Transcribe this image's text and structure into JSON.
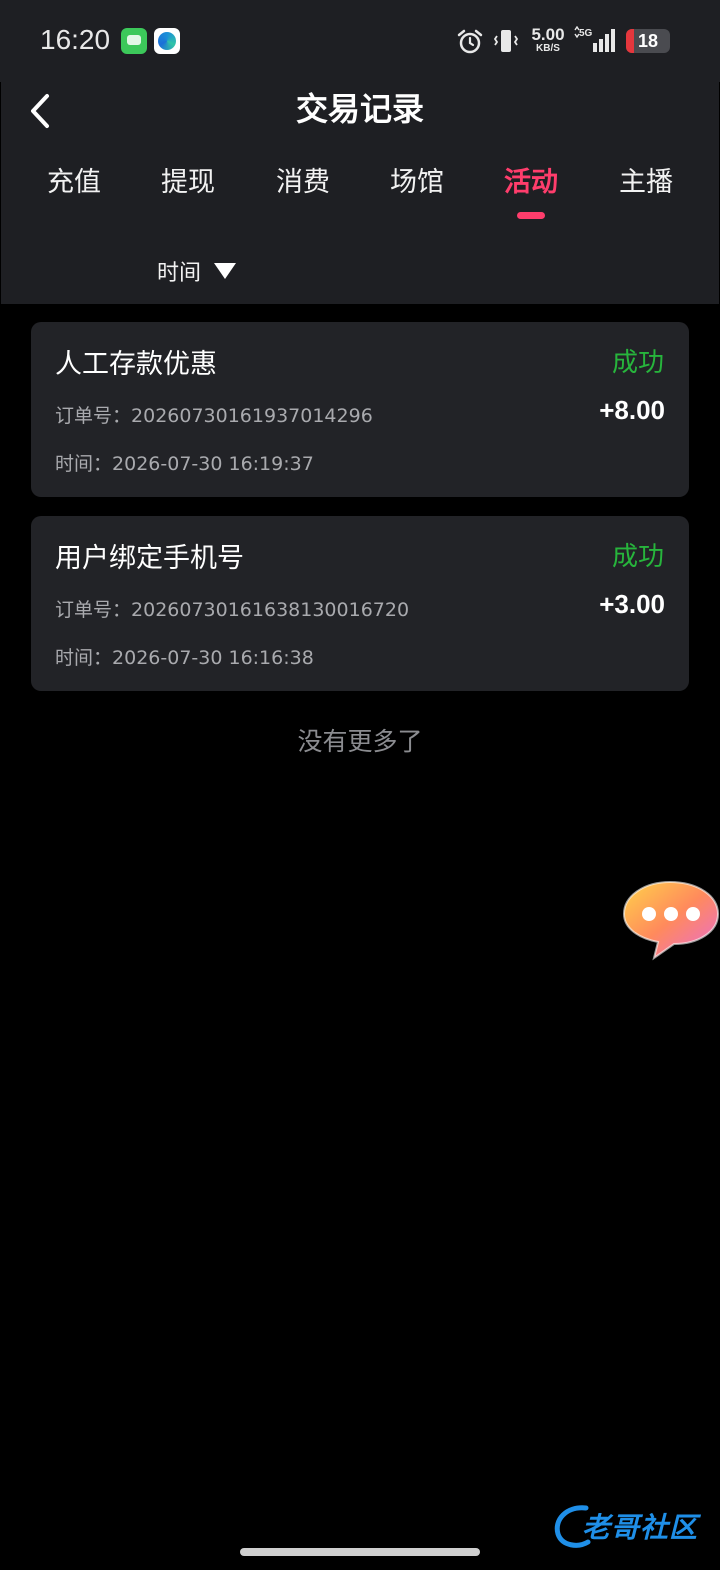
{
  "status_bar": {
    "time": "16:20",
    "net_speed": "5.00",
    "net_speed_unit": "KB/S",
    "network_type": "5G",
    "battery_level": "18",
    "battery_fraction": 0.18,
    "icons": [
      "messages-app-icon",
      "edge-browser-icon",
      "alarm-icon",
      "vibrate-icon",
      "signal-icon",
      "battery-icon"
    ]
  },
  "header": {
    "title": "交易记录",
    "back_icon": "chevron-left-icon"
  },
  "tabs": [
    {
      "label": "充值",
      "active": false
    },
    {
      "label": "提现",
      "active": false
    },
    {
      "label": "消费",
      "active": false
    },
    {
      "label": "场馆",
      "active": false
    },
    {
      "label": "活动",
      "active": true
    },
    {
      "label": "主播",
      "active": false
    }
  ],
  "filter": {
    "label": "时间",
    "icon": "caret-down-icon"
  },
  "records": [
    {
      "title": "人工存款优惠",
      "status": "成功",
      "order_label": "订单号：",
      "order_no": "20260730161937014296",
      "amount": "+8.00",
      "time_label": "时间：",
      "time": "2026-07-30 16:19:37"
    },
    {
      "title": "用户绑定手机号",
      "status": "成功",
      "order_label": "订单号：",
      "order_no": "20260730161638130016720",
      "amount": "+3.00",
      "time_label": "时间：",
      "time": "2026-07-30 16:16:38"
    }
  ],
  "footer_text": "没有更多了",
  "floating_chat_icon": "chat-bubble-icon",
  "watermark_text": "老哥社区",
  "colors": {
    "accent": "#ff3d6c",
    "success": "#27b53c",
    "header_bg": "#1e1f23",
    "card_bg": "#222327",
    "page_bg": "#000000"
  }
}
